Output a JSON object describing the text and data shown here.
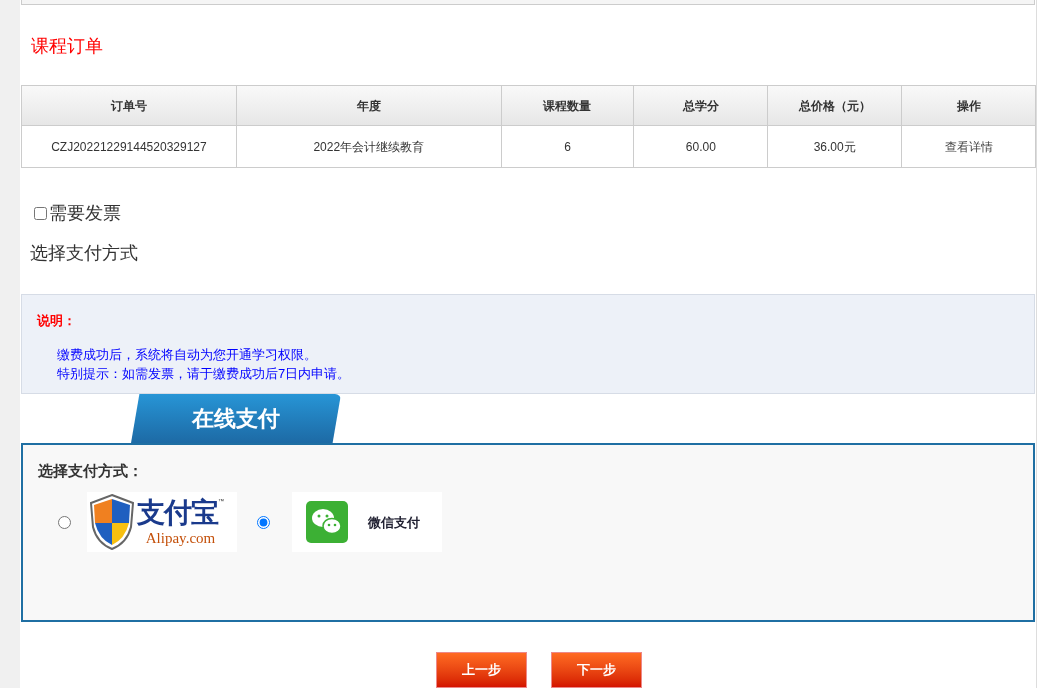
{
  "section_title": "课程订单",
  "table": {
    "columns": [
      "订单号",
      "年度",
      "课程数量",
      "总学分",
      "总价格（元）",
      "操作"
    ],
    "rows": [
      {
        "cells": [
          "CZJ20221229144520329127",
          "2022年会计继续教育",
          "6",
          "60.00",
          "36.00元"
        ],
        "action": "查看详情"
      }
    ]
  },
  "invoice": {
    "label": "需要发票",
    "checked": false
  },
  "payment_heading": "选择支付方式",
  "notice": {
    "title": "说明：",
    "lines": [
      "缴费成功后，系统将自动为您开通学习权限。",
      "特别提示：如需发票，请于缴费成功后7日内申请。"
    ]
  },
  "payment_tab": "在线支付",
  "payment_box": {
    "label": "选择支付方式：",
    "options": [
      {
        "kind": "alipay",
        "selected": false,
        "logo_text": "支付宝",
        "logo_tm": "™",
        "logo_domain": "Alipay.com"
      },
      {
        "kind": "wechat",
        "selected": true,
        "label": "微信支付"
      }
    ]
  },
  "buttons": [
    "上一步",
    "下一步"
  ]
}
